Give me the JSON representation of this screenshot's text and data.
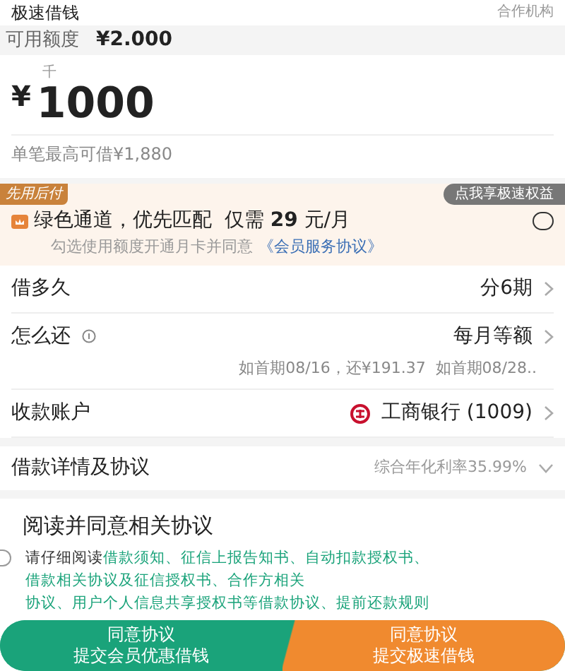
{
  "header": {
    "title": "极速借钱",
    "partner": "合作机构"
  },
  "credit": {
    "label": "可用额度",
    "value": "¥2.000"
  },
  "amount": {
    "currency": "¥",
    "unit_hint": "千",
    "value": "1000",
    "limit": "单笔最高可借¥1,880"
  },
  "member": {
    "tag": "先用后付",
    "tooltip": "点我享极速权益",
    "headline": "绿色通道，优先匹配  仅需",
    "price": "29",
    "price_unit": "元/月",
    "note": "勾选使用额度开通月卡并同意",
    "link": "《会员服务协议》",
    "checked": false
  },
  "rows": [
    {
      "kind": "term",
      "label": "借多久",
      "value": "分6期"
    },
    {
      "kind": "repay",
      "label": "怎么还",
      "value": "每月等额",
      "sub": "如首期08/16，还¥191.37  如首期08/28.."
    },
    {
      "kind": "account",
      "label": "收款账户",
      "value": "工商银行 (1009)"
    }
  ],
  "details": {
    "label": "借款详情及协议",
    "rate": "综合年化利率35.99%",
    "expanded": false
  },
  "agreement": {
    "title": "阅读并同意相关协议",
    "checked": false,
    "intro": "请仔细阅读",
    "links": [
      "借款须知、",
      "征信上报告知书、",
      "自动扣款授权书、",
      "借款相关协议及征信授权书、",
      "合作方相关",
      "协议、用户个人信息共享授权书等借款协议、",
      "提前还款规则"
    ]
  },
  "buttons": [
    {
      "line1": "同意协议",
      "line2": "提交会员优惠借钱",
      "kind": "member"
    },
    {
      "line1": "同意协议",
      "line2": "提交极速借钱",
      "kind": "fast"
    }
  ]
}
